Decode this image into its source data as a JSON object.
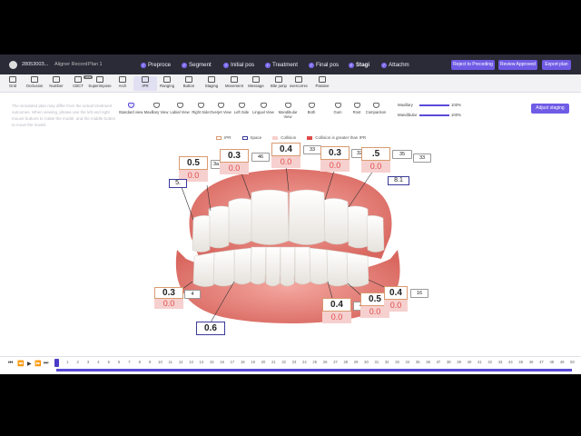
{
  "titlebar": {
    "patient_id": "2805300З...",
    "record": "Aligner Record",
    "plan": "Plan 1",
    "steps": [
      "Preproce",
      "Segment",
      "Initial pos",
      "Treatment",
      "Final pos",
      "Stagi",
      "Attachm"
    ],
    "buttons": {
      "reject": "Reject to Preceding",
      "approve": "Review Approved",
      "export": "Export plan"
    }
  },
  "toolbar": {
    "items": [
      "Grid",
      "Occlusion",
      "Number",
      "CBCT",
      "Superimpose",
      "Arch",
      "IPR",
      "Ranging",
      "Button",
      "Staging",
      "Movement",
      "Message",
      "Bite jump",
      "overcorrec",
      "Passive"
    ],
    "new_badge": "new"
  },
  "views": {
    "items": [
      "Standard view",
      "Maxillary View",
      "Labial View",
      "Right Side",
      "Overjet View",
      "Left Side",
      "Lingual View",
      "Mandibular View",
      "Both",
      "Gum",
      "Root",
      "Comparison"
    ]
  },
  "sliders": {
    "maxillary_label": "Maxillary",
    "maxillary_value": "100%",
    "mandibular_label": "Mandibular",
    "mandibular_value": "100%"
  },
  "adjust_button": "Adjust staging",
  "note": "The simulated plan may differ from the actual treatment outcomes. When viewing, please use the left and right mouse buttons to rotate the model, and the middle button to move the model.",
  "legend": [
    "IPR",
    "Space",
    "Collision",
    "Collision is greater than IPR"
  ],
  "colors": {
    "accent": "#6e5ce6",
    "collision": "#e04a4a",
    "gum": "#e8837e",
    "ipr_border": "#d99a70"
  },
  "labels": {
    "upper": [
      {
        "ipr": "0.5",
        "collision": "0.0",
        "tag": "3a"
      },
      {
        "ipr": "0.3",
        "collision": "0.0",
        "tag": "46"
      },
      {
        "ipr": "0.4",
        "collision": "0.0",
        "tag": "33"
      },
      {
        "ipr": "0.3",
        "collision": "0.0",
        "tag": "32"
      },
      {
        "ipr": ".5",
        "collision": "0.0",
        "tag": "35"
      }
    ],
    "upper_extra": [
      "33",
      "5.",
      "8.1"
    ],
    "lower": [
      {
        "ipr": "0.3",
        "collision": "0.0",
        "tag": "4"
      },
      {
        "ipr": "0.4",
        "collision": "0.0",
        "tag": "44"
      },
      {
        "ipr": "0.5",
        "collision": "0.0",
        "tag": "31"
      },
      {
        "ipr": "0.4",
        "collision": "0.0",
        "tag": "16"
      }
    ],
    "space": "0.6"
  },
  "timeline": {
    "controls": [
      "⏮",
      "⏪",
      "▶",
      "⏩",
      "⏭"
    ],
    "ticks": [
      "0",
      "1",
      "2",
      "3",
      "4",
      "5",
      "6",
      "7",
      "8",
      "9",
      "10",
      "11",
      "12",
      "13",
      "14",
      "15",
      "16",
      "17",
      "18",
      "19",
      "20",
      "21",
      "22",
      "23",
      "24",
      "25",
      "26",
      "27",
      "28",
      "29",
      "30",
      "31",
      "32",
      "33",
      "34",
      "35",
      "36",
      "37",
      "38",
      "39",
      "40",
      "41",
      "42",
      "43",
      "44",
      "45",
      "46",
      "47",
      "48",
      "49",
      "50"
    ]
  }
}
